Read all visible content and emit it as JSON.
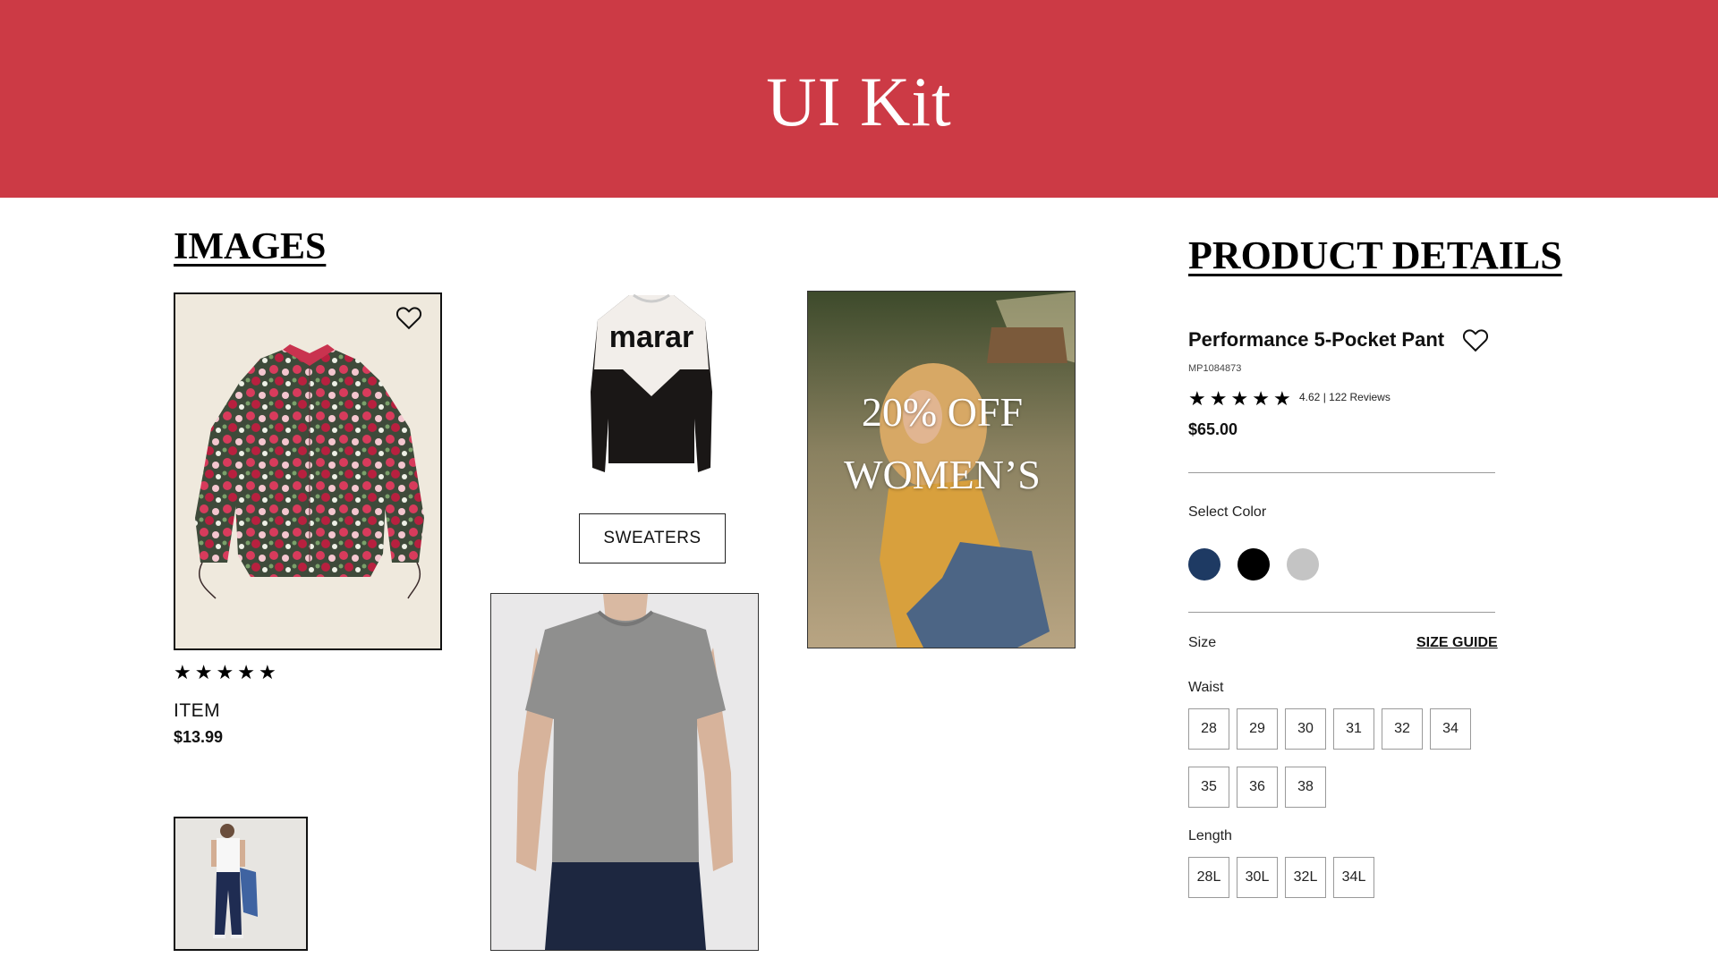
{
  "header": {
    "title": "UI Kit"
  },
  "images_section": {
    "title": "IMAGES",
    "card": {
      "label": "ITEM",
      "price": "$13.99",
      "rating_stars": 5
    },
    "sweater_button": "SWEATERS",
    "promo": {
      "line1": "20% OFF",
      "line2": "WOMEN’S"
    }
  },
  "product_details": {
    "title": "PRODUCT DETAILS",
    "name": "Performance 5-Pocket Pant",
    "sku": "MP1084873",
    "rating_text": "4.62 | 122 Reviews",
    "price": "$65.00",
    "select_color_label": "Select Color",
    "colors": [
      "#1e3a63",
      "#000000",
      "#c4c4c4"
    ],
    "size_label": "Size",
    "size_guide": "SIZE GUIDE",
    "waist_label": "Waist",
    "waist_sizes": [
      "28",
      "29",
      "30",
      "31",
      "32",
      "34",
      "35",
      "36",
      "38"
    ],
    "length_label": "Length",
    "length_sizes": [
      "28L",
      "30L",
      "32L",
      "34L"
    ]
  },
  "colors": {
    "header": "#cc3a45"
  }
}
